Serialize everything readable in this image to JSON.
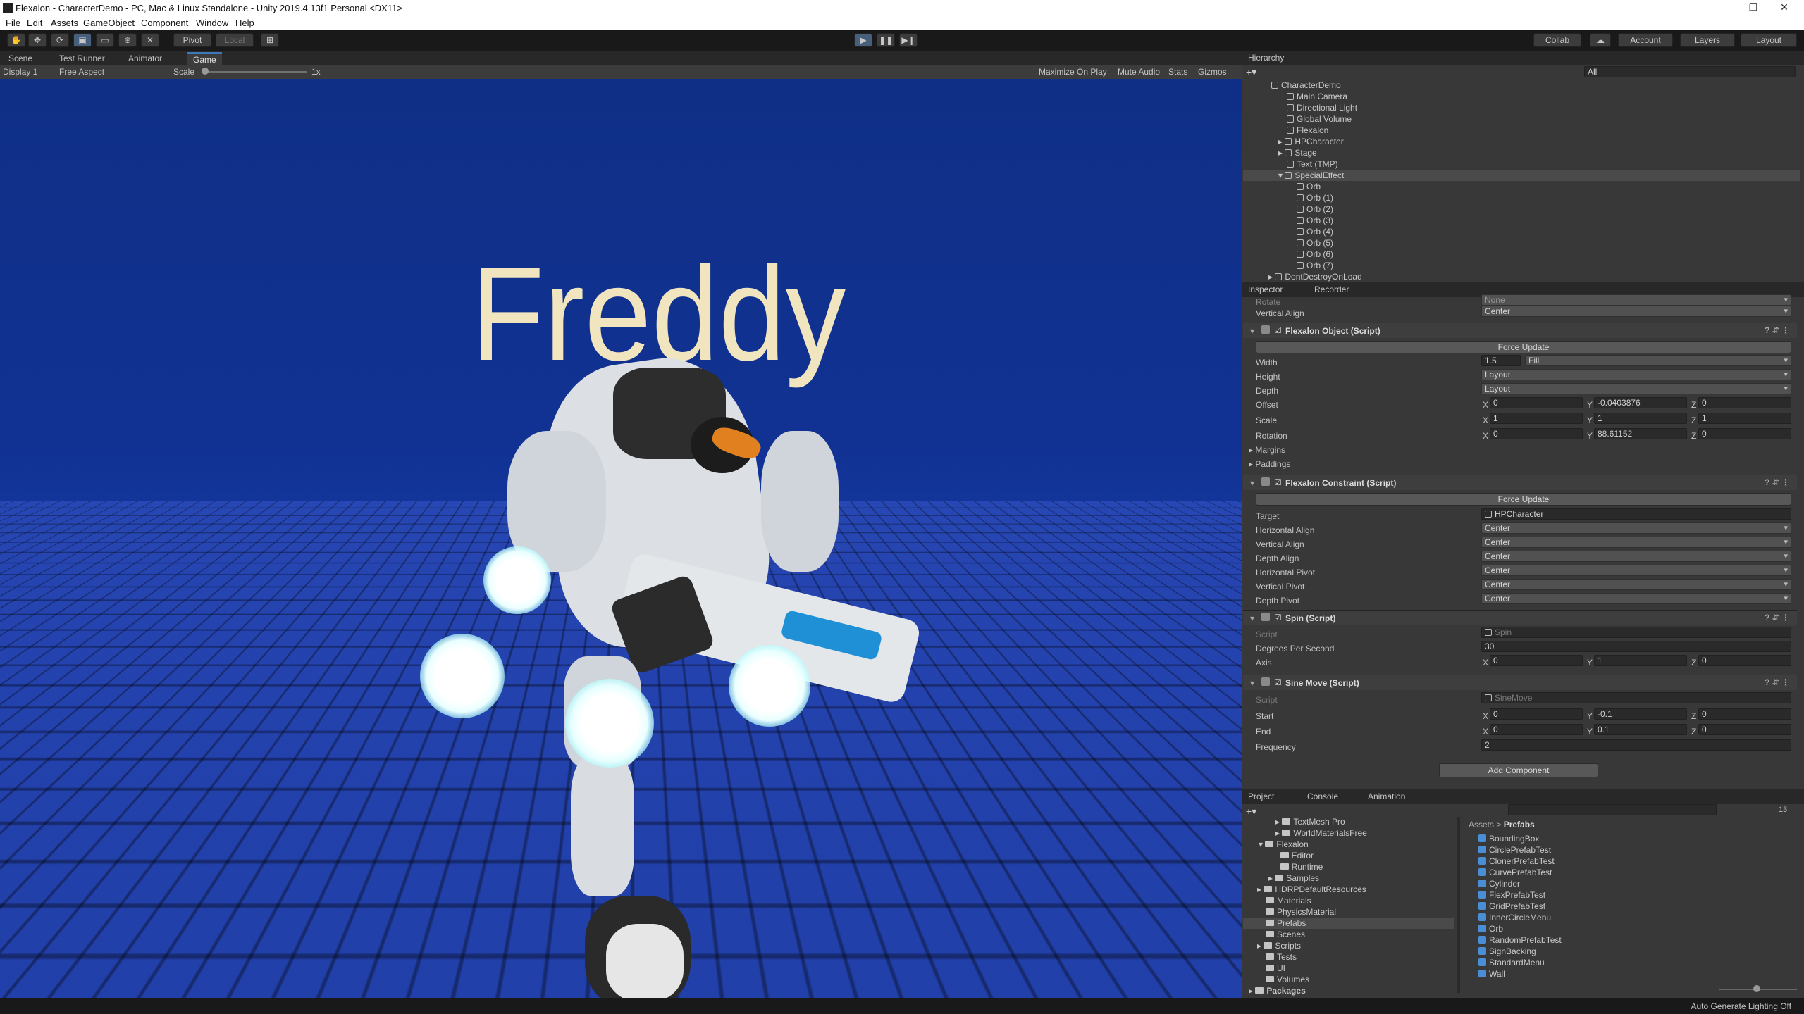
{
  "window": {
    "title": "Flexalon - CharacterDemo - PC, Mac & Linux Standalone - Unity 2019.4.13f1 Personal <DX11>",
    "minimize": "—",
    "maximize": "❐",
    "close": "✕"
  },
  "menu": [
    "File",
    "Edit",
    "Assets",
    "GameObject",
    "Component",
    "Window",
    "Help"
  ],
  "toolbar": {
    "pivot": "Pivot",
    "local": "Local",
    "collab": "Collab",
    "account": "Account",
    "layers": "Layers",
    "layout": "Layout"
  },
  "view_tabs": [
    "Scene",
    "Test Runner",
    "Animator",
    "Game"
  ],
  "game_toolbar": {
    "display": "Display 1",
    "aspect": "Free Aspect",
    "scale_label": "Scale",
    "scale_value": "1x",
    "maximize_on_play": "Maximize On Play",
    "mute_audio": "Mute Audio",
    "stats": "Stats",
    "gizmos": "Gizmos"
  },
  "scene_text": "Freddy",
  "hierarchy": {
    "tab": "Hierarchy",
    "search_placeholder": "All",
    "items": [
      "CharacterDemo",
      "Main Camera",
      "Directional Light",
      "Global Volume",
      "Flexalon",
      "HPCharacter",
      "Stage",
      "Text (TMP)",
      "SpecialEffect",
      "Orb",
      "Orb (1)",
      "Orb (2)",
      "Orb (3)",
      "Orb (4)",
      "Orb (5)",
      "Orb (6)",
      "Orb (7)",
      "DontDestroyOnLoad"
    ]
  },
  "inspector": {
    "tabs": [
      "Inspector",
      "Recorder"
    ],
    "top_rows": {
      "rotate_label": "Rotate",
      "rotate_value": "None",
      "valign_label": "Vertical Align",
      "valign_value": "Center"
    },
    "flexalon_object": {
      "title": "Flexalon Object (Script)",
      "force_update": "Force Update",
      "width_label": "Width",
      "width_value": "1.5",
      "width_mode": "Fill",
      "height_label": "Height",
      "height_value": "Layout",
      "depth_label": "Depth",
      "depth_value": "Layout",
      "offset_label": "Offset",
      "offset": {
        "x": "0",
        "y": "-0.0403876",
        "z": "0"
      },
      "scale_label": "Scale",
      "scale": {
        "x": "1",
        "y": "1",
        "z": "1"
      },
      "rotation_label": "Rotation",
      "rotation": {
        "x": "0",
        "y": "88.61152",
        "z": "0"
      },
      "margins": "Margins",
      "paddings": "Paddings"
    },
    "flexalon_constraint": {
      "title": "Flexalon Constraint (Script)",
      "force_update": "Force Update",
      "target_label": "Target",
      "target_value": "HPCharacter",
      "rows": [
        {
          "label": "Horizontal Align",
          "value": "Center"
        },
        {
          "label": "Vertical Align",
          "value": "Center"
        },
        {
          "label": "Depth Align",
          "value": "Center"
        },
        {
          "label": "Horizontal Pivot",
          "value": "Center"
        },
        {
          "label": "Vertical Pivot",
          "value": "Center"
        },
        {
          "label": "Depth Pivot",
          "value": "Center"
        }
      ]
    },
    "spin": {
      "title": "Spin (Script)",
      "script_label": "Script",
      "script_value": "Spin",
      "dps_label": "Degrees Per Second",
      "dps_value": "30",
      "axis_label": "Axis",
      "axis": {
        "x": "0",
        "y": "1",
        "z": "0"
      }
    },
    "sine_move": {
      "title": "Sine Move (Script)",
      "script_label": "Script",
      "script_value": "SineMove",
      "start_label": "Start",
      "start": {
        "x": "0",
        "y": "-0.1",
        "z": "0"
      },
      "end_label": "End",
      "end": {
        "x": "0",
        "y": "0.1",
        "z": "0"
      },
      "freq_label": "Frequency",
      "freq_value": "2"
    },
    "add_component": "Add Component"
  },
  "project": {
    "tabs": [
      "Project",
      "Console",
      "Animation"
    ],
    "count_badge": "13",
    "tree": [
      "TextMesh Pro",
      "WorldMaterialsFree",
      "Flexalon",
      "Editor",
      "Runtime",
      "Samples",
      "HDRPDefaultResources",
      "Materials",
      "PhysicsMaterial",
      "Prefabs",
      "Scenes",
      "Scripts",
      "Tests",
      "UI",
      "Volumes",
      "Packages"
    ],
    "breadcrumb": [
      "Assets",
      "Prefabs"
    ],
    "assets": [
      "BoundingBox",
      "CirclePrefabTest",
      "ClonerPrefabTest",
      "CurvePrefabTest",
      "Cylinder",
      "FlexPrefabTest",
      "GridPrefabTest",
      "InnerCircleMenu",
      "Orb",
      "RandomPrefabTest",
      "SignBacking",
      "StandardMenu",
      "Wall"
    ]
  },
  "status": {
    "right": "Auto Generate Lighting Off"
  },
  "colors": {
    "accent": "#3a79bb",
    "sky": "#12339a",
    "text_cream": "#f1e5c0"
  }
}
